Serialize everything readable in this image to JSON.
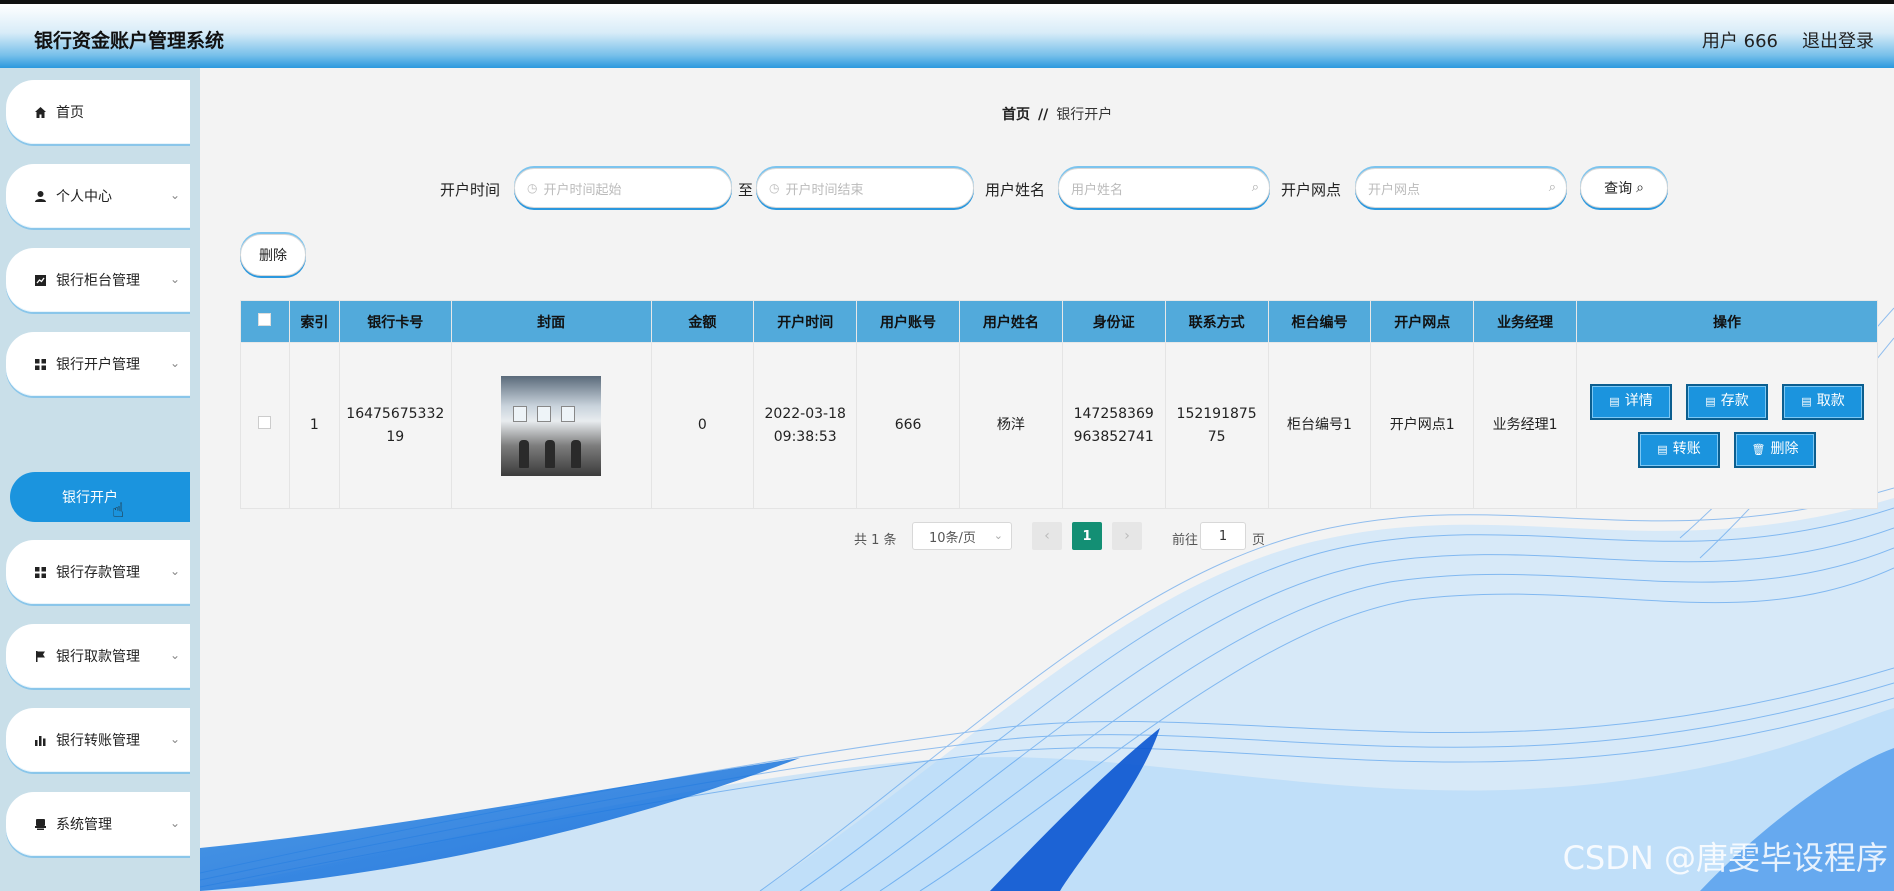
{
  "app": {
    "title": "银行资金账户管理系统",
    "user": "用户 666",
    "logout": "退出登录"
  },
  "sidebar": {
    "items": [
      {
        "label": "首页",
        "icon": "home-icon"
      },
      {
        "label": "个人中心",
        "icon": "user-icon"
      },
      {
        "label": "银行柜台管理",
        "icon": "chart-icon"
      },
      {
        "label": "银行开户管理",
        "icon": "grid-icon"
      },
      {
        "label": "银行存款管理",
        "icon": "grid-icon"
      },
      {
        "label": "银行取款管理",
        "icon": "flag-icon"
      },
      {
        "label": "银行转账管理",
        "icon": "bar-chart-icon"
      },
      {
        "label": "系统管理",
        "icon": "printer-icon"
      }
    ],
    "active_sub": "银行开户"
  },
  "breadcrumb": {
    "home": "首页",
    "sep": "//",
    "current": "银行开户"
  },
  "search": {
    "open_time_label": "开户时间",
    "start_placeholder": "开户时间起始",
    "to_label": "至",
    "end_placeholder": "开户时间结束",
    "name_label": "用户姓名",
    "name_placeholder": "用户姓名",
    "branch_label": "开户网点",
    "branch_placeholder": "开户网点",
    "query_button": "查询"
  },
  "toolbar": {
    "delete_label": "删除"
  },
  "table": {
    "headers": [
      "索引",
      "银行卡号",
      "封面",
      "金额",
      "开户时间",
      "用户账号",
      "用户姓名",
      "身份证",
      "联系方式",
      "柜台编号",
      "开户网点",
      "业务经理",
      "操作"
    ],
    "rows": [
      {
        "index": "1",
        "card_line1": "16475675332",
        "card_line2": "19",
        "amount": "0",
        "time_line1": "2022-03-18",
        "time_line2": "09:38:53",
        "account": "666",
        "name": "杨洋",
        "id_line1": "147258369",
        "id_line2": "963852741",
        "phone_line1": "152191875",
        "phone_line2": "75",
        "counter": "柜台编号1",
        "branch": "开户网点1",
        "manager": "业务经理1"
      }
    ],
    "actions": {
      "detail": "详情",
      "deposit": "存款",
      "withdraw": "取款",
      "transfer": "转账",
      "delete": "删除"
    }
  },
  "pagination": {
    "total": "共 1 条",
    "page_size": "10条/页",
    "current_page": "1",
    "goto": "前往",
    "goto_value": "1",
    "page_unit": "页"
  },
  "watermark": "CSDN @唐雯毕设程序",
  "colors": {
    "accent": "#1b94de",
    "header_th": "#52aadb",
    "active_page": "#138f74"
  }
}
